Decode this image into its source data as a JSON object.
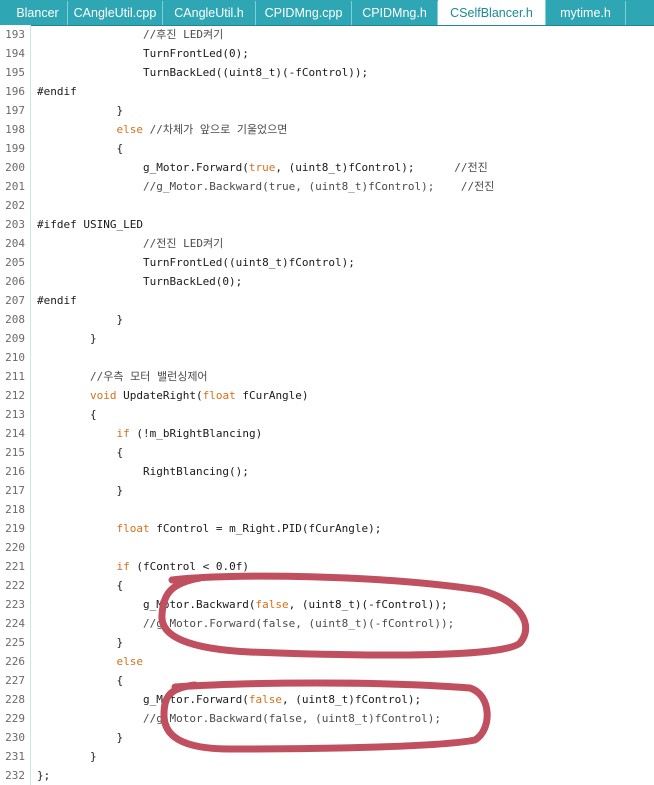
{
  "tabs": [
    "Blancer",
    "CAngleUtil.cpp",
    "CAngleUtil.h",
    "CPIDMng.cpp",
    "CPIDMng.h",
    "CSelfBlancer.h",
    "mytime.h"
  ],
  "active_tab": 5,
  "colors": {
    "tabbar": "#2fa6b4",
    "keyword": "#d6701a",
    "highlight_marker": "#c0505f"
  },
  "lines": [
    {
      "n": "193",
      "t": "                //후진 LED켜기"
    },
    {
      "n": "194",
      "t": "                TurnFrontLed(0);"
    },
    {
      "n": "195",
      "t": "                TurnBackLed((uint8_t)(-fControl));"
    },
    {
      "n": "196",
      "t": "#endif"
    },
    {
      "n": "197",
      "t": "            }"
    },
    {
      "n": "198",
      "t": "            else //차체가 앞으로 기울었으면"
    },
    {
      "n": "199",
      "t": "            {"
    },
    {
      "n": "200",
      "t": "                g_Motor.Forward(true, (uint8_t)fControl);      //전진"
    },
    {
      "n": "201",
      "t": "                //g_Motor.Backward(true, (uint8_t)fControl);    //전진"
    },
    {
      "n": "202",
      "t": ""
    },
    {
      "n": "203",
      "t": "#ifdef USING_LED"
    },
    {
      "n": "204",
      "t": "                //전진 LED켜기"
    },
    {
      "n": "205",
      "t": "                TurnFrontLed((uint8_t)fControl);"
    },
    {
      "n": "206",
      "t": "                TurnBackLed(0);"
    },
    {
      "n": "207",
      "t": "#endif"
    },
    {
      "n": "208",
      "t": "            }"
    },
    {
      "n": "209",
      "t": "        }"
    },
    {
      "n": "210",
      "t": ""
    },
    {
      "n": "211",
      "t": "        //우측 모터 밸런싱제어"
    },
    {
      "n": "212",
      "t": "        void UpdateRight(float fCurAngle)"
    },
    {
      "n": "213",
      "t": "        {"
    },
    {
      "n": "214",
      "t": "            if (!m_bRightBlancing)"
    },
    {
      "n": "215",
      "t": "            {"
    },
    {
      "n": "216",
      "t": "                RightBlancing();"
    },
    {
      "n": "217",
      "t": "            }"
    },
    {
      "n": "218",
      "t": ""
    },
    {
      "n": "219",
      "t": "            float fControl = m_Right.PID(fCurAngle);"
    },
    {
      "n": "220",
      "t": ""
    },
    {
      "n": "221",
      "t": "            if (fControl < 0.0f)"
    },
    {
      "n": "222",
      "t": "            {"
    },
    {
      "n": "223",
      "t": "                g_Motor.Backward(false, (uint8_t)(-fControl));"
    },
    {
      "n": "224",
      "t": "                //g_Motor.Forward(false, (uint8_t)(-fControl));"
    },
    {
      "n": "225",
      "t": "            }"
    },
    {
      "n": "226",
      "t": "            else"
    },
    {
      "n": "227",
      "t": "            {"
    },
    {
      "n": "228",
      "t": "                g_Motor.Forward(false, (uint8_t)fControl);"
    },
    {
      "n": "229",
      "t": "                //g_Motor.Backward(false, (uint8_t)fControl);"
    },
    {
      "n": "230",
      "t": "            }"
    },
    {
      "n": "231",
      "t": "        }"
    },
    {
      "n": "232",
      "t": "};"
    }
  ]
}
